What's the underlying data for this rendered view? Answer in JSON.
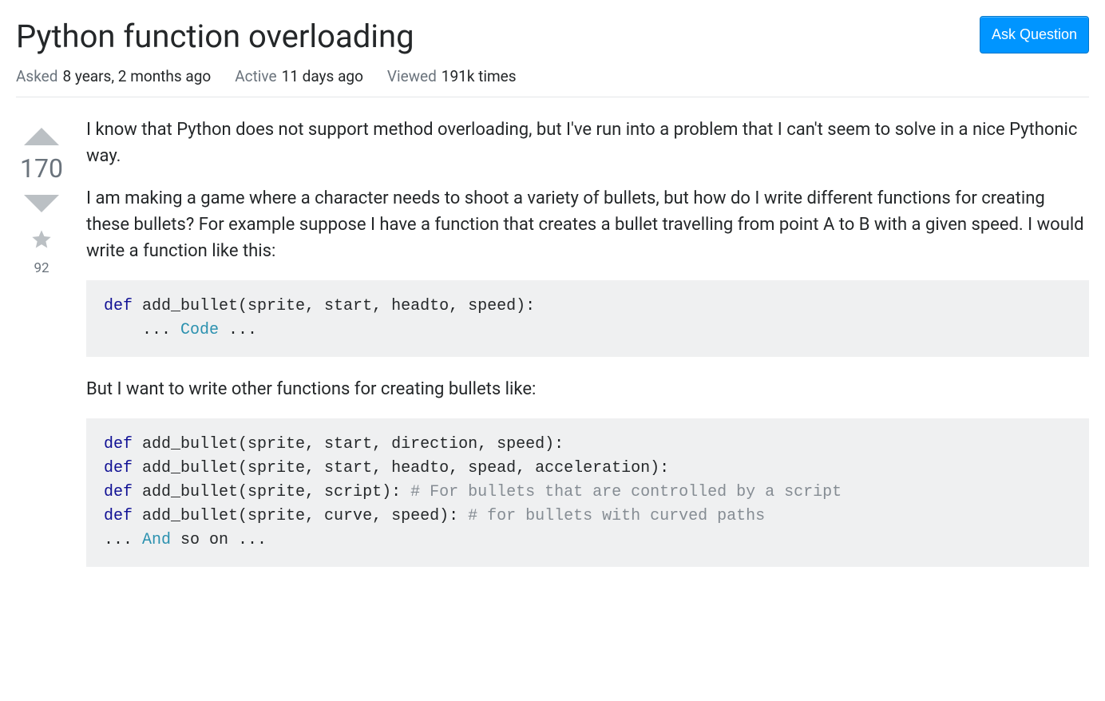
{
  "header": {
    "title": "Python function overloading",
    "askButton": "Ask Question"
  },
  "meta": {
    "askedLabel": "Asked",
    "askedValue": "8 years, 2 months ago",
    "activeLabel": "Active",
    "activeValue": "11 days ago",
    "viewedLabel": "Viewed",
    "viewedValue": "191k times"
  },
  "vote": {
    "score": "170",
    "favorites": "92"
  },
  "post": {
    "para1": "I know that Python does not support method overloading, but I've run into a problem that I can't seem to solve in a nice Pythonic way.",
    "para2": "I am making a game where a character needs to shoot a variety of bullets, but how do I write different functions for creating these bullets? For example suppose I have a function that creates a bullet travelling from point A to B with a given speed. I would write a function like this:",
    "para3": "But I want to write other functions for creating bullets like:",
    "code1": {
      "kw": "def",
      "rest1": " add_bullet(sprite, start, headto, speed):",
      "line2a": "    ... ",
      "typ1": "Code",
      "line2b": " ..."
    },
    "code2": {
      "kw": "def",
      "l1": " add_bullet(sprite, start, direction, speed):",
      "l2": " add_bullet(sprite, start, headto, spead, acceleration):",
      "l3a": " add_bullet(sprite, script): ",
      "c3": "# For bullets that are controlled by a script",
      "l4a": " add_bullet(sprite, curve, speed): ",
      "c4": "# for bullets with curved paths",
      "l5a": "... ",
      "typ5": "And",
      "l5b": " so on ..."
    }
  },
  "colors": {
    "arrow": "#bbc0c4",
    "button": "#0095ff"
  }
}
